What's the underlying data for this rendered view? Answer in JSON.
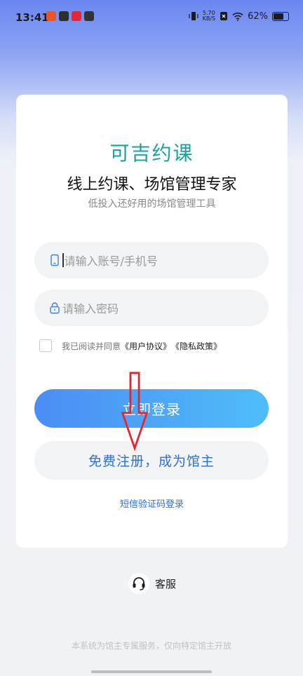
{
  "status_bar": {
    "time": "13:41",
    "net_speed_value": "5.70",
    "net_speed_unit": "KB/S",
    "battery_percent": "62%",
    "battery_level": 0.62
  },
  "card": {
    "title": "可吉约课",
    "subtitle": "线上约课、场馆管理专家",
    "tagline": "低投入还好用的场馆管理工具",
    "account_input_placeholder": "请输入账号/手机号",
    "password_input_placeholder": "请输入密码",
    "agreement_prefix": "我已阅读并同意",
    "user_agreement": "《用户协议》",
    "privacy_policy": "《隐私政策》",
    "login_button": "立即登录",
    "register_button": "免费注册，成为馆主",
    "sms_login_link": "短信验证码登录"
  },
  "service": {
    "label": "客服"
  },
  "footer_note": "本系统为馆主专属服务，仅向特定馆主开放",
  "colors": {
    "brand_teal": "#1aa39a",
    "link_blue": "#2f6fd6",
    "login_gradient_start": "#4b8df5",
    "login_gradient_end": "#4fbdf8",
    "annotation_red": "#e8242a"
  },
  "icons": {
    "account_field": "phone-icon",
    "password_field": "lock-icon",
    "service": "headset-icon"
  }
}
